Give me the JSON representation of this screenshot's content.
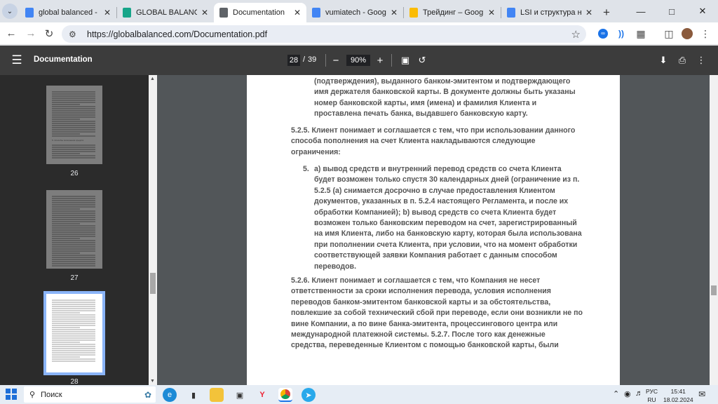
{
  "browser": {
    "tabs": [
      {
        "title": "global balanced - Goog",
        "color": "#4285f4",
        "active": false
      },
      {
        "title": "GLOBAL BALANCED FU",
        "color": "#17a589",
        "active": false
      },
      {
        "title": "Documentation",
        "color": "#5f6368",
        "active": true
      },
      {
        "title": "vumiatech - Google До",
        "color": "#4285f4",
        "active": false
      },
      {
        "title": "Трейдинг – Google Ди",
        "color": "#fbbc04",
        "active": false
      },
      {
        "title": "LSI и структура новые",
        "color": "#4285f4",
        "active": false
      }
    ],
    "new_tab_label": "+",
    "address": "https://globalbalanced.com/Documentation.pdf"
  },
  "pdf_viewer": {
    "title": "Documentation",
    "current_page": "28",
    "page_separator": "/",
    "total_pages": "39",
    "zoom": "90%"
  },
  "thumbnails": [
    {
      "page": "26",
      "selected": false,
      "heading": "5. Способы пополнения средств"
    },
    {
      "page": "27",
      "selected": false
    },
    {
      "page": "28",
      "selected": true
    }
  ],
  "page_content": {
    "para1": [
      "(подтверждения), выданного банком-эмитентом и подтверждающего",
      "имя держателя банковской карты. В документе должны быть указаны",
      "номер банковской карты, имя (имена) и фамилия Клиента и",
      "проставлена печать банка, выдавшего банковскую карту."
    ],
    "para2": [
      "5.2.5. Клиент понимает и соглашается с тем, что при использовании данного",
      "способа пополнения на счет Клиента накладываются следующие",
      "ограничения:"
    ],
    "list_number": "5.",
    "list_item": [
      "a) вывод средств и внутренний перевод средств со счета Клиента",
      "будет возможен только спустя 30 календарных дней (ограничение из п.",
      "5.2.5 (а) снимается досрочно в случае предоставления Клиентом",
      "документов, указанных в п. 5.2.4 настоящего Регламента, и после их",
      "обработки Компанией); b) вывод средств со счета Клиента будет",
      "возможен только банковским переводом на счет, зарегистрированный",
      "на имя Клиента, либо на банковскую карту, которая была использована",
      "при пополнении счета Клиента, при условии, что на момент обработки",
      "соответствующей заявки Компания работает с данным способом",
      "переводов."
    ],
    "para3": [
      "5.2.6. Клиент понимает и соглашается с тем, что Компания не несет",
      "ответственности за сроки исполнения перевода, условия исполнения",
      "переводов банком-эмитентом банковской карты и за обстоятельства,",
      "повлекшие за собой технический сбой при переводе, если они возникли не по",
      "вине Компании, а по вине банка-эмитента, процессингового центра или",
      "международной платежной системы. 5.2.7. После того как денежные",
      "средства, переведенные Клиентом с помощью банковской карты, были"
    ]
  },
  "taskbar": {
    "search_label": "Поиск",
    "lang_top": "РУС",
    "lang_bottom": "RU",
    "time": "15:41",
    "date": "18.02.2024"
  }
}
